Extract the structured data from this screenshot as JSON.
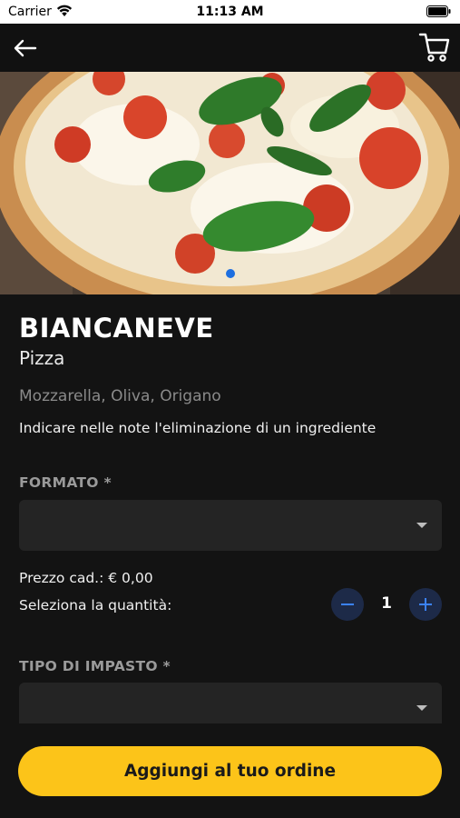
{
  "status_bar": {
    "carrier": "Carrier",
    "time": "11:13 AM"
  },
  "nav": {
    "back_icon": "arrow-left-icon",
    "cart_icon": "shopping-cart-icon"
  },
  "product": {
    "name": "BIANCANEVE",
    "category": "Pizza",
    "ingredients": "Mozzarella, Oliva, Origano",
    "note": "Indicare nelle note l'eliminazione di un ingrediente",
    "image_pages": 1,
    "image_current_page": 1
  },
  "options": {
    "formato_label": "FORMATO *",
    "formato_value": "",
    "impasto_label": "TIPO DI IMPASTO *",
    "impasto_value": ""
  },
  "pricing": {
    "price_label": "Prezzo cad.: € 0,00",
    "quantity_label": "Seleziona la quantità:",
    "quantity": "1"
  },
  "actions": {
    "add_button": "Aggiungi al tuo ordine"
  },
  "colors": {
    "background": "#131313",
    "accent_yellow": "#fcc419",
    "stepper_blue": "#3b82f6",
    "page_dot": "#1e6fe0"
  }
}
